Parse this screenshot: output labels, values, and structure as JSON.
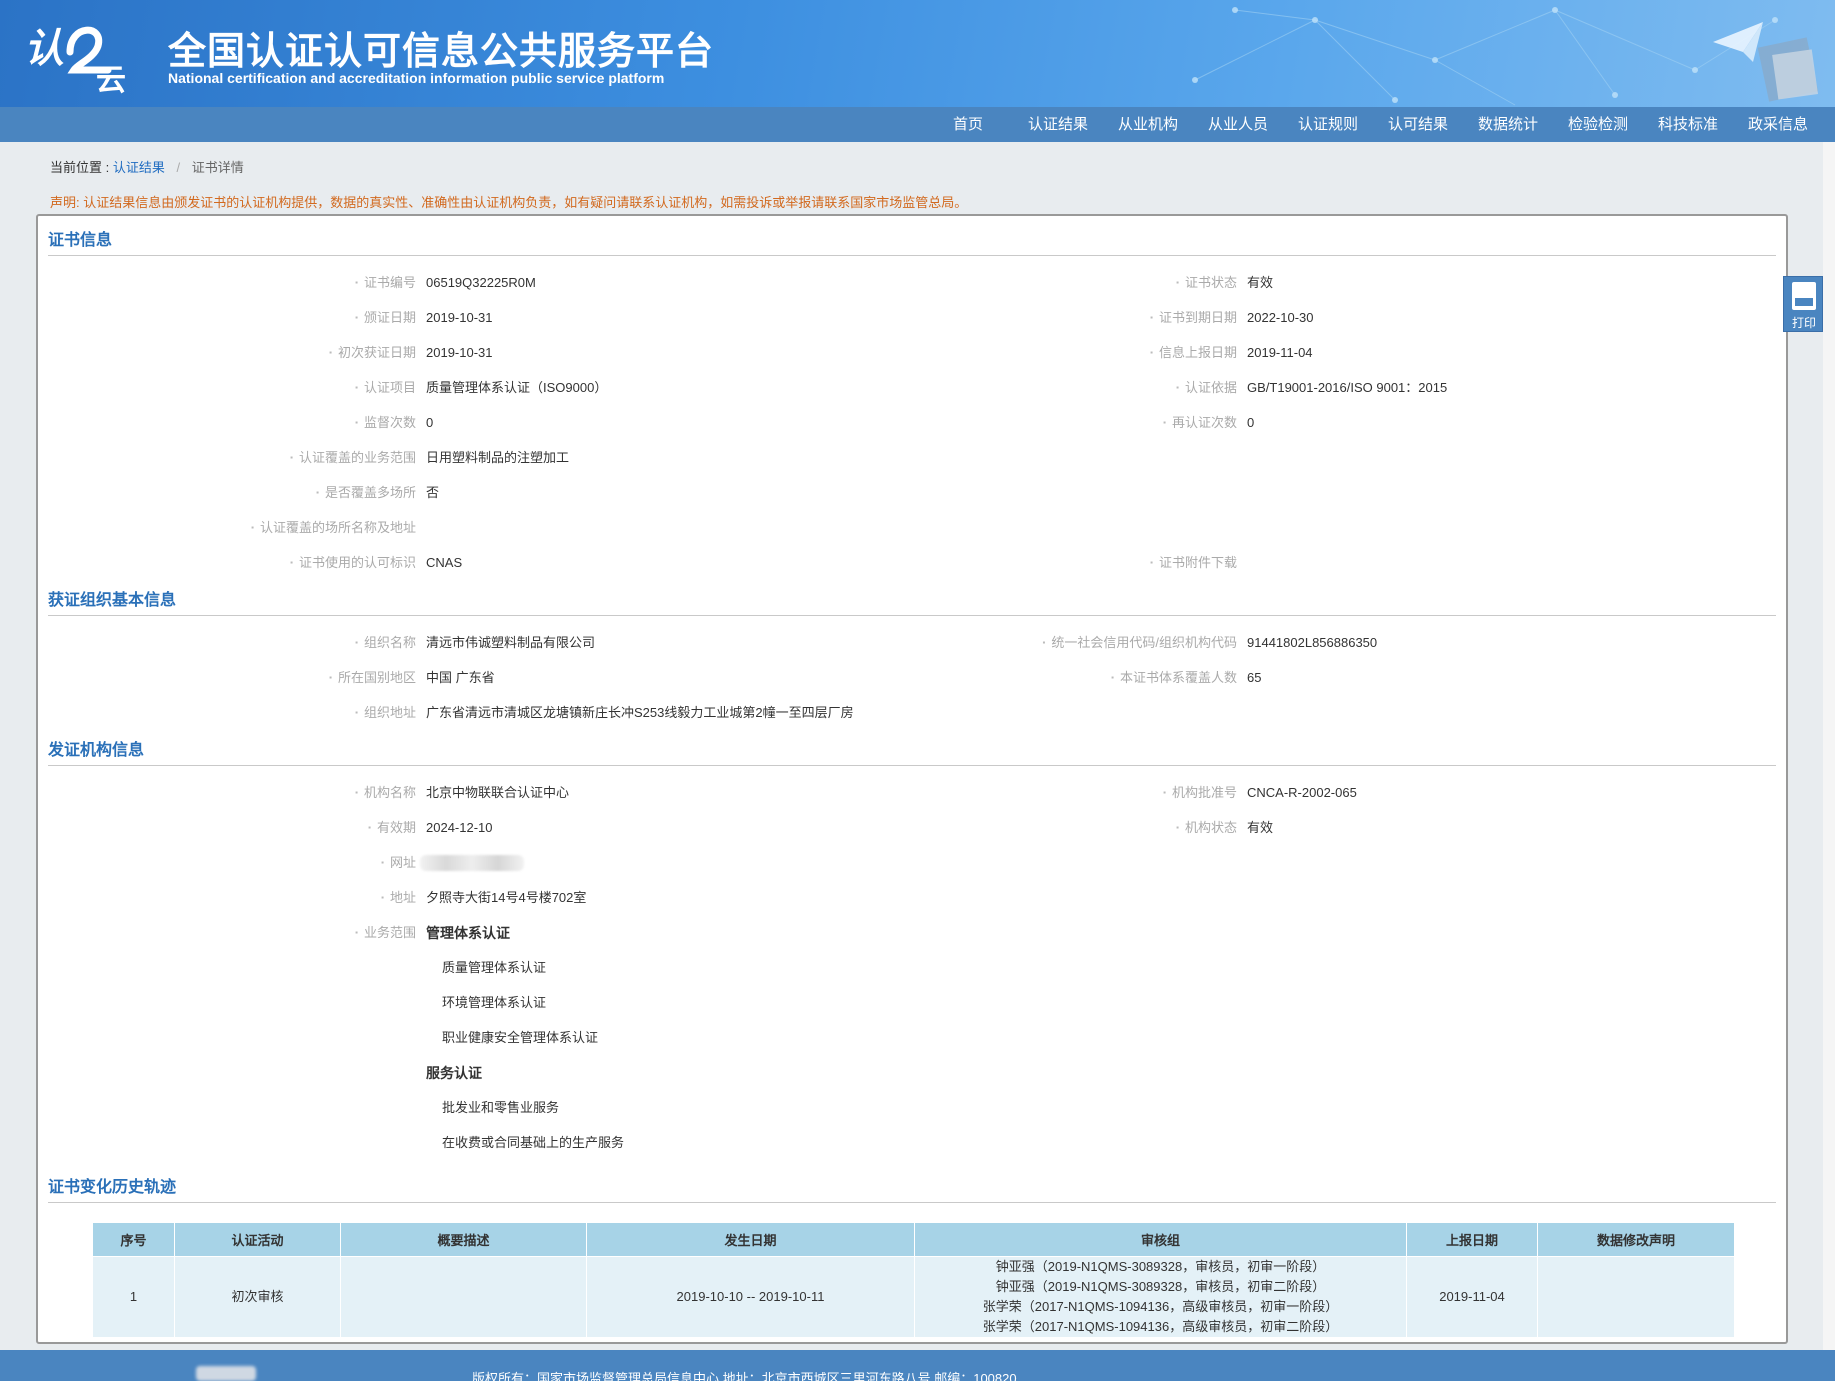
{
  "header": {
    "logo_text": "认证云",
    "title": "全国认证认可信息公共服务平台",
    "subtitle": "National certification and accreditation information public service platform"
  },
  "nav": [
    "首页",
    "认证结果",
    "从业机构",
    "从业人员",
    "认证规则",
    "认可结果",
    "数据统计",
    "检验检测",
    "科技标准",
    "政采信息"
  ],
  "breadcrumb": {
    "prefix": "当前位置 :",
    "link": "认证结果",
    "sep": "/",
    "current": "证书详情"
  },
  "disclaimer": "声明: 认证结果信息由颁发证书的认证机构提供，数据的真实性、准确性由认证机构负责，如有疑问请联系认证机构，如需投诉或举报请联系国家市场监管总局。",
  "print_label": "打印",
  "cert": {
    "title": "证书信息",
    "left": [
      {
        "label": "证书编号",
        "value": "06519Q32225R0M"
      },
      {
        "label": "颁证日期",
        "value": "2019-10-31"
      },
      {
        "label": "初次获证日期",
        "value": "2019-10-31"
      },
      {
        "label": "认证项目",
        "value": "质量管理体系认证（ISO9000）"
      },
      {
        "label": "监督次数",
        "value": "0"
      },
      {
        "label": "认证覆盖的业务范围",
        "value": "日用塑料制品的注塑加工"
      },
      {
        "label": "是否覆盖多场所",
        "value": "否"
      },
      {
        "label": "认证覆盖的场所名称及地址",
        "value": ""
      },
      {
        "label": "证书使用的认可标识",
        "value": "CNAS"
      }
    ],
    "right": [
      {
        "label": "证书状态",
        "value": "有效"
      },
      {
        "label": "证书到期日期",
        "value": "2022-10-30"
      },
      {
        "label": "信息上报日期",
        "value": "2019-11-04"
      },
      {
        "label": "认证依据",
        "value": "GB/T19001-2016/ISO 9001：2015"
      },
      {
        "label": "再认证次数",
        "value": "0"
      }
    ],
    "attachment_label": "证书附件下载"
  },
  "org": {
    "title": "获证组织基本信息",
    "left": [
      {
        "label": "组织名称",
        "value": "清远市伟诚塑料制品有限公司"
      },
      {
        "label": "所在国别地区",
        "value": "中国 广东省"
      },
      {
        "label": "组织地址",
        "value": "广东省清远市清城区龙塘镇新庄长冲S253线毅力工业城第2幢一至四层厂房"
      }
    ],
    "right": [
      {
        "label": "统一社会信用代码/组织机构代码",
        "value": "91441802L856886350"
      },
      {
        "label": "本证书体系覆盖人数",
        "value": "65"
      }
    ]
  },
  "issuer": {
    "title": "发证机构信息",
    "left": [
      {
        "label": "机构名称",
        "value": "北京中物联联合认证中心"
      },
      {
        "label": "有效期",
        "value": "2024-12-10"
      },
      {
        "label": "网址",
        "value": ""
      },
      {
        "label": "地址",
        "value": "夕照寺大街14号4号楼702室"
      },
      {
        "label": "业务范围",
        "value": "管理体系认证"
      }
    ],
    "right": [
      {
        "label": "机构批准号",
        "value": "CNCA-R-2002-065"
      },
      {
        "label": "机构状态",
        "value": "有效"
      }
    ],
    "scope_mgmt": [
      "质量管理体系认证",
      "环境管理体系认证",
      "职业健康安全管理体系认证"
    ],
    "scope_service_title": "服务认证",
    "scope_service": [
      "批发业和零售业服务",
      "在收费或合同基础上的生产服务"
    ]
  },
  "history": {
    "title": "证书变化历史轨迹",
    "columns": [
      "序号",
      "认证活动",
      "概要描述",
      "发生日期",
      "审核组",
      "上报日期",
      "数据修改声明"
    ],
    "rows": [
      {
        "no": "1",
        "activity": "初次审核",
        "desc": "",
        "date": "2019-10-10 -- 2019-10-11",
        "auditors": [
          "钟亚强（2019-N1QMS-3089328，审核员，初审一阶段）",
          "钟亚强（2019-N1QMS-3089328，审核员，初审二阶段）",
          "张学荣（2017-N1QMS-1094136，高级审核员，初审一阶段）",
          "张学荣（2017-N1QMS-1094136，高级审核员，初审二阶段）"
        ],
        "report_date": "2019-11-04",
        "statement": ""
      }
    ]
  },
  "footer": "版权所有：国家市场监督管理总局信息中心    地址：北京市西城区三里河东路八号    邮编：100820",
  "colors": {
    "nav": "#4a85c0",
    "section_title": "#2a70b8",
    "disclaimer": "#d2691e",
    "table_head": "#a7d3e7"
  }
}
